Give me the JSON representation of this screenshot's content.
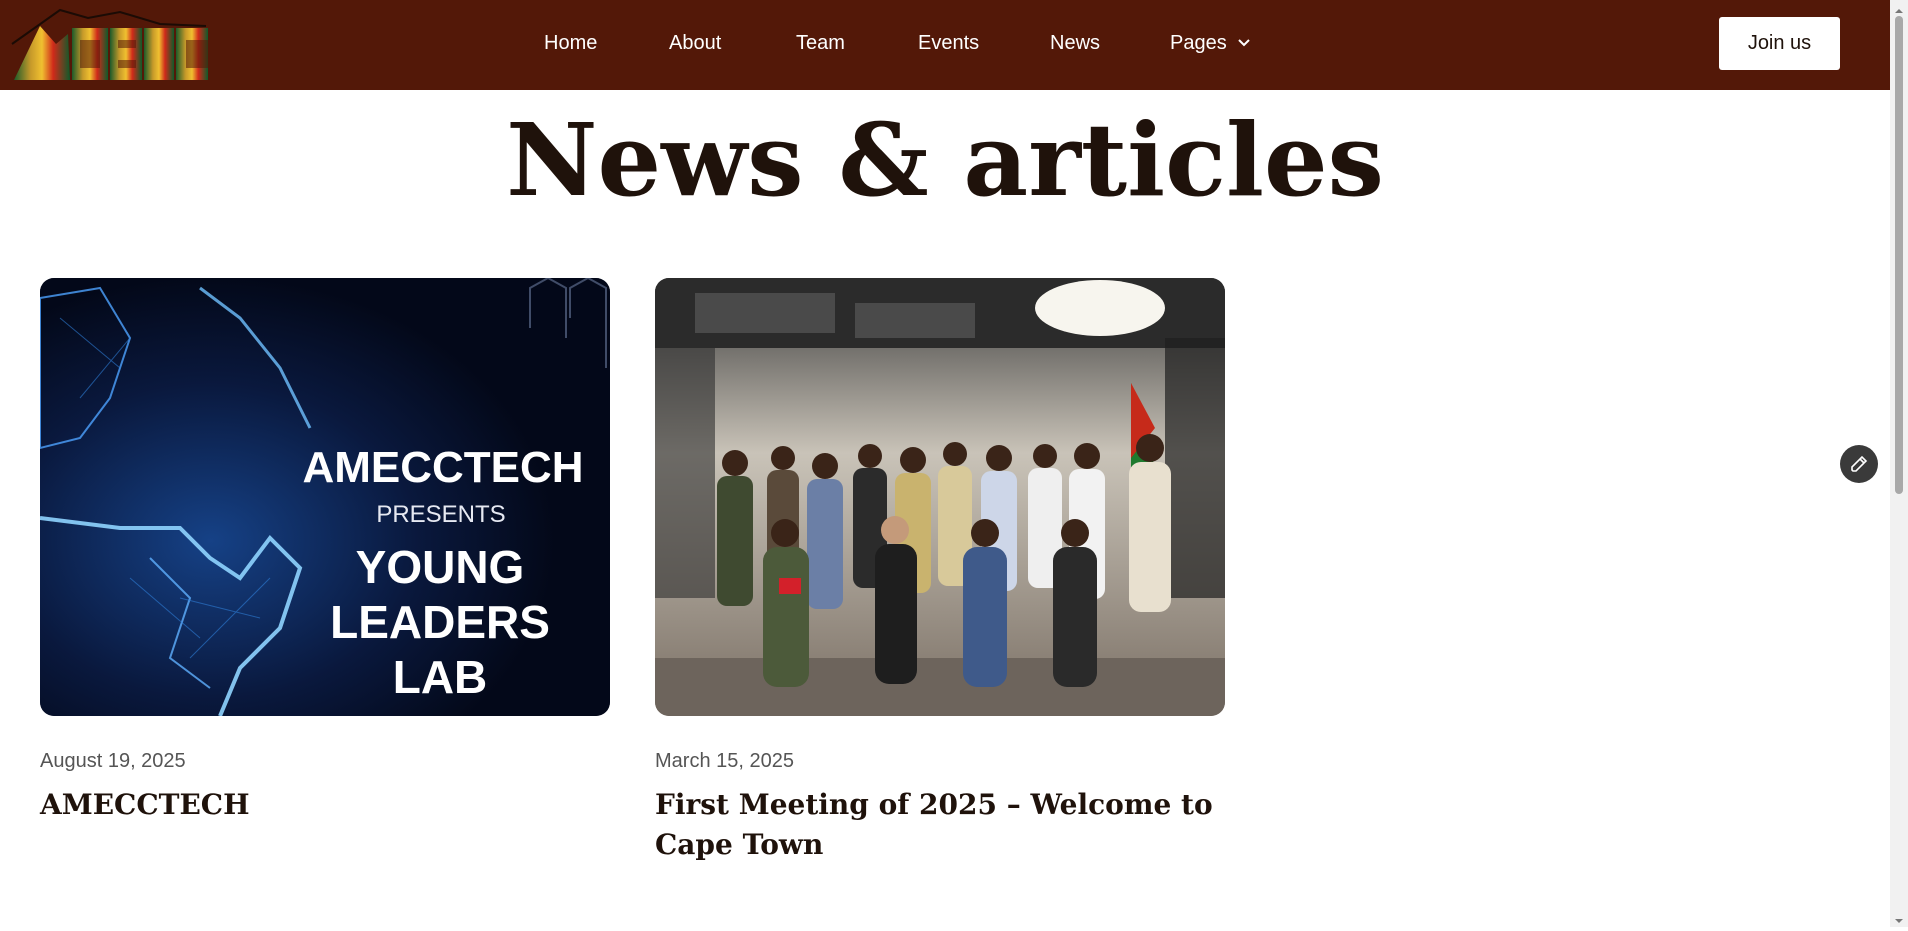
{
  "header": {
    "logo_text": "AMECC",
    "nav": [
      {
        "label": "Home"
      },
      {
        "label": "About"
      },
      {
        "label": "Team"
      },
      {
        "label": "Events"
      },
      {
        "label": "News"
      },
      {
        "label": "Pages"
      }
    ],
    "join_label": "Join us"
  },
  "main": {
    "title": "News & articles",
    "articles": [
      {
        "date": "August 19, 2025",
        "title": "AMECCTECH",
        "image_text": {
          "line1": "AMECCTECH",
          "line2": "PRESENTS",
          "line3": "YOUNG",
          "line4": "LEADERS",
          "line5": "LAB"
        }
      },
      {
        "date": "March 15, 2025",
        "title": "First Meeting of 2025 – Welcome to Cape Town"
      }
    ]
  },
  "icons": {
    "dropdown": "chevron-down-icon",
    "edit": "pencil-icon"
  },
  "colors": {
    "header_bg": "#531808",
    "text_dark": "#1f120b",
    "button_bg": "#ffffff"
  }
}
